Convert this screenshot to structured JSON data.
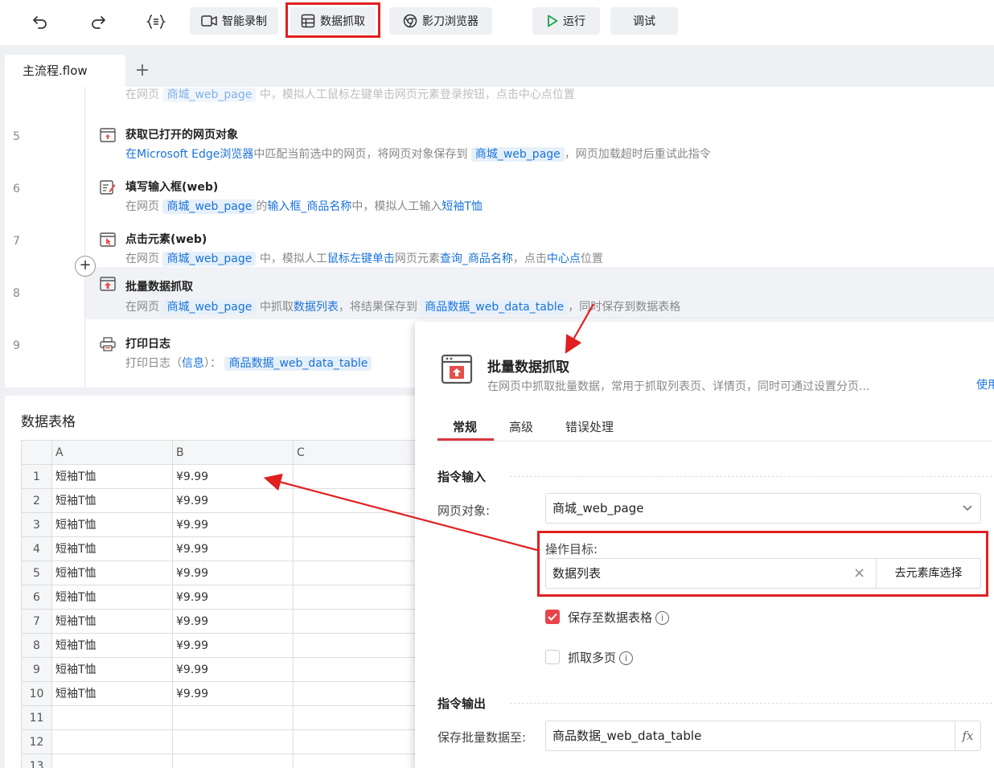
{
  "toolbar": {
    "smart_record": "智能录制",
    "data_capture": "数据抓取",
    "browser": "影刀浏览器",
    "run": "运行",
    "debug": "调试"
  },
  "tabs": {
    "active": "主流程.flow",
    "add": "+"
  },
  "flow": {
    "cut_line": {
      "prefix": "在网页",
      "var": "商城_web_page",
      "mid": "中，模拟人工鼠标左键单击网页元素登录按钮，点击中心点位置"
    },
    "steps": [
      {
        "num": "5",
        "title": "获取已打开的网页对象",
        "d1": "在Microsoft Edge浏览器",
        "d2": "中匹配当前选中的网页，将网页对象保存到",
        "d3": "商城_web_page",
        "d4": "，网页加载超时后重试此指令"
      },
      {
        "num": "6",
        "title": "填写输入框(web)",
        "d1": "在网页",
        "d2": "商城_web_page",
        "d3": "的",
        "d4": "输入框_商品名称",
        "d5": "中，模拟人工输入",
        "d6": "短袖T恤"
      },
      {
        "num": "7",
        "title": "点击元素(web)",
        "d1": "在网页",
        "d2": "商城_web_page",
        "d3": "中，模拟人工",
        "d4": "鼠标左键单击",
        "d5": "网页元素",
        "d6": "查询_商品名称",
        "d7": "，点击",
        "d8": "中心点",
        "d9": "位置"
      },
      {
        "num": "8",
        "title": "批量数据抓取",
        "d1": "在网页",
        "d2": "商城_web_page",
        "d3": "中抓取",
        "d4": "数据列表",
        "d5": "，将结果保存到",
        "d6": "商品数据_web_data_table",
        "d7": "，同时保存到数据表格"
      },
      {
        "num": "9",
        "title": "打印日志",
        "d1": "打印日志（",
        "d2": "信息",
        "d3": "）：",
        "d4": "商品数据_web_data_table"
      }
    ]
  },
  "datatable": {
    "title": "数据表格",
    "columns": [
      "A",
      "B",
      "C"
    ],
    "rows": [
      {
        "n": "1",
        "a": "短袖T恤",
        "b": "¥9.99"
      },
      {
        "n": "2",
        "a": "短袖T恤",
        "b": "¥9.99"
      },
      {
        "n": "3",
        "a": "短袖T恤",
        "b": "¥9.99"
      },
      {
        "n": "4",
        "a": "短袖T恤",
        "b": "¥9.99"
      },
      {
        "n": "5",
        "a": "短袖T恤",
        "b": "¥9.99"
      },
      {
        "n": "6",
        "a": "短袖T恤",
        "b": "¥9.99"
      },
      {
        "n": "7",
        "a": "短袖T恤",
        "b": "¥9.99"
      },
      {
        "n": "8",
        "a": "短袖T恤",
        "b": "¥9.99"
      },
      {
        "n": "9",
        "a": "短袖T恤",
        "b": "¥9.99"
      },
      {
        "n": "10",
        "a": "短袖T恤",
        "b": "¥9.99"
      },
      {
        "n": "11",
        "a": "",
        "b": ""
      },
      {
        "n": "12",
        "a": "",
        "b": ""
      },
      {
        "n": "13",
        "a": "",
        "b": ""
      }
    ]
  },
  "dialog": {
    "title": "批量数据抓取",
    "desc": "在网页中抓取批量数据，常用于抓取列表页、详情页，同时可通过设置分页...",
    "link": "使用",
    "tabs": [
      "常规",
      "高级",
      "错误处理"
    ],
    "section_input": "指令输入",
    "web_object_label": "网页对象:",
    "web_object_value": "商城_web_page",
    "target_label": "操作目标:",
    "target_value": "数据列表",
    "clear": "×",
    "library_button": "去元素库选择",
    "save_to_table": "保存至数据表格",
    "capture_pages": "抓取多页",
    "section_output": "指令输出",
    "save_label": "保存批量数据至:",
    "save_value": "商品数据_web_data_table",
    "fx": "fx"
  },
  "colors": {
    "accent_red": "#e02020",
    "link_blue": "#1a73d9",
    "check_red": "#e8454a"
  }
}
